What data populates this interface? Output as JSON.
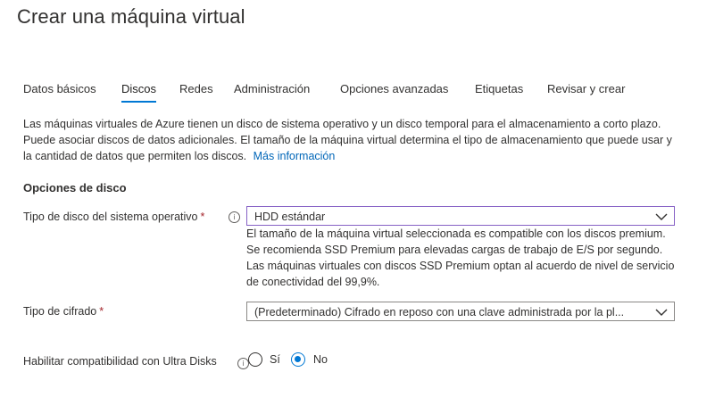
{
  "page": {
    "title": "Crear una máquina virtual"
  },
  "tabs": [
    {
      "label": "Datos básicos"
    },
    {
      "label": "Discos"
    },
    {
      "label": "Redes"
    },
    {
      "label": "Administración"
    },
    {
      "label": "Opciones avanzadas"
    },
    {
      "label": "Etiquetas"
    },
    {
      "label": "Revisar y crear"
    }
  ],
  "active_tab": "Discos",
  "description": {
    "text": "Las máquinas virtuales de Azure tienen un disco de sistema operativo y un disco temporal para el almacenamiento a corto plazo. Puede asociar discos de datos adicionales. El tamaño de la máquina virtual determina el tipo de almacenamiento que puede usar y la cantidad de datos que permiten los discos.",
    "link": "Más información"
  },
  "disk_options": {
    "heading": "Opciones de disco",
    "os_disk_type": {
      "label": "Tipo de disco del sistema operativo",
      "required_mark": "*",
      "info_icon": "info-icon",
      "value": "HDD estándar",
      "help": "El tamaño de la máquina virtual seleccionada es compatible con los discos premium. Se recomienda SSD Premium para elevadas cargas de trabajo de E/S por segundo. Las máquinas virtuales con discos SSD Premium optan al acuerdo de nivel de servicio de conectividad del 99,9%."
    },
    "encryption_type": {
      "label": "Tipo de cifrado",
      "required_mark": "*",
      "value": "(Predeterminado) Cifrado en reposo con una clave administrada por la pl..."
    },
    "ultra_disks": {
      "label": "Habilitar compatibilidad con Ultra Disks",
      "info_icon": "info-icon",
      "options": [
        "Sí",
        "No"
      ],
      "selected": "No"
    }
  },
  "colors": {
    "accent": "#0078d4",
    "link": "#0066b8",
    "required": "#a4262c",
    "focus_border": "#8661c5"
  }
}
